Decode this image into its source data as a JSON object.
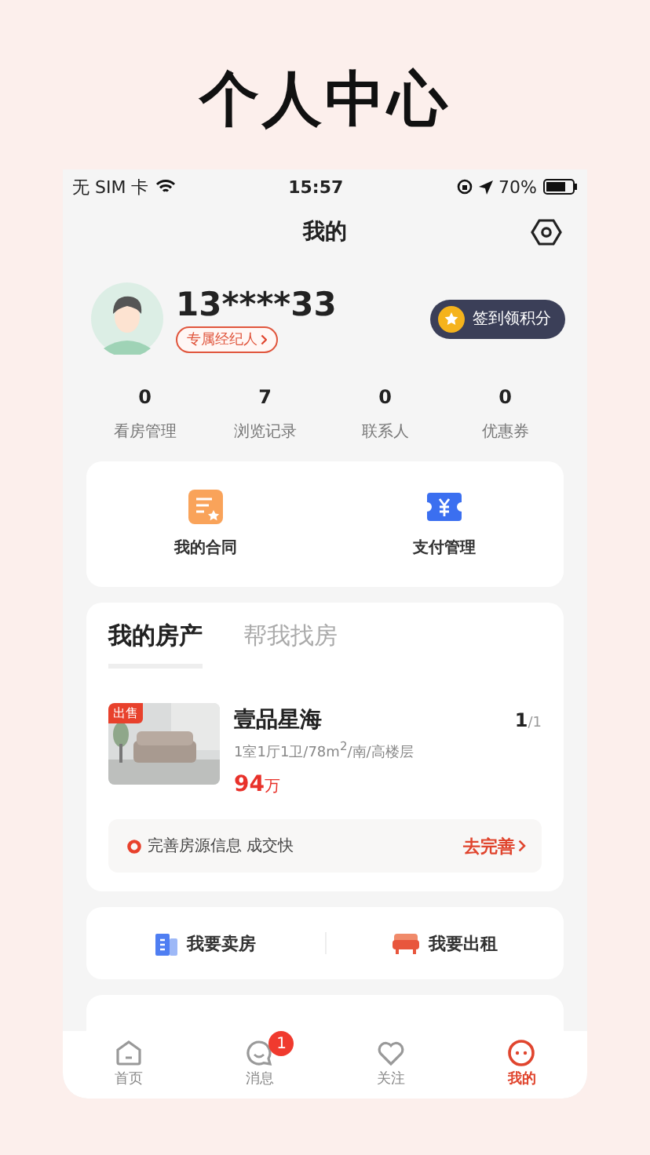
{
  "page_title": "个人中心",
  "status_bar": {
    "carrier": "无 SIM 卡",
    "time": "15:57",
    "battery": "70%"
  },
  "nav": {
    "title": "我的"
  },
  "profile": {
    "phone": "13****33",
    "agent_label": "专属经纪人",
    "checkin_label": "签到领积分"
  },
  "stats": [
    {
      "value": "0",
      "label": "看房管理"
    },
    {
      "value": "7",
      "label": "浏览记录"
    },
    {
      "value": "0",
      "label": "联系人"
    },
    {
      "value": "0",
      "label": "优惠券"
    }
  ],
  "services": [
    {
      "kind": "contract",
      "label": "我的合同"
    },
    {
      "kind": "payment",
      "label": "支付管理"
    }
  ],
  "property_tabs": [
    {
      "label": "我的房产",
      "selected": true
    },
    {
      "label": "帮我找房",
      "selected": false
    }
  ],
  "listing": {
    "tag": "出售",
    "name": "壹品星海",
    "details": "1室1厅1卫/78m$^{2}$/南/高楼层",
    "price": "94",
    "price_unit": "万",
    "page_current": "1",
    "page_total": "/1"
  },
  "tip": {
    "text": "完善房源信息 成交快",
    "action": "去完善"
  },
  "actions": [
    {
      "kind": "sell",
      "label": "我要卖房"
    },
    {
      "kind": "rent",
      "label": "我要出租"
    }
  ],
  "tab_bar": [
    {
      "kind": "home",
      "label": "首页",
      "selected": false
    },
    {
      "kind": "message",
      "label": "消息",
      "selected": false,
      "badge": "1"
    },
    {
      "kind": "heart",
      "label": "关注",
      "selected": false
    },
    {
      "kind": "me",
      "label": "我的",
      "selected": true
    }
  ]
}
